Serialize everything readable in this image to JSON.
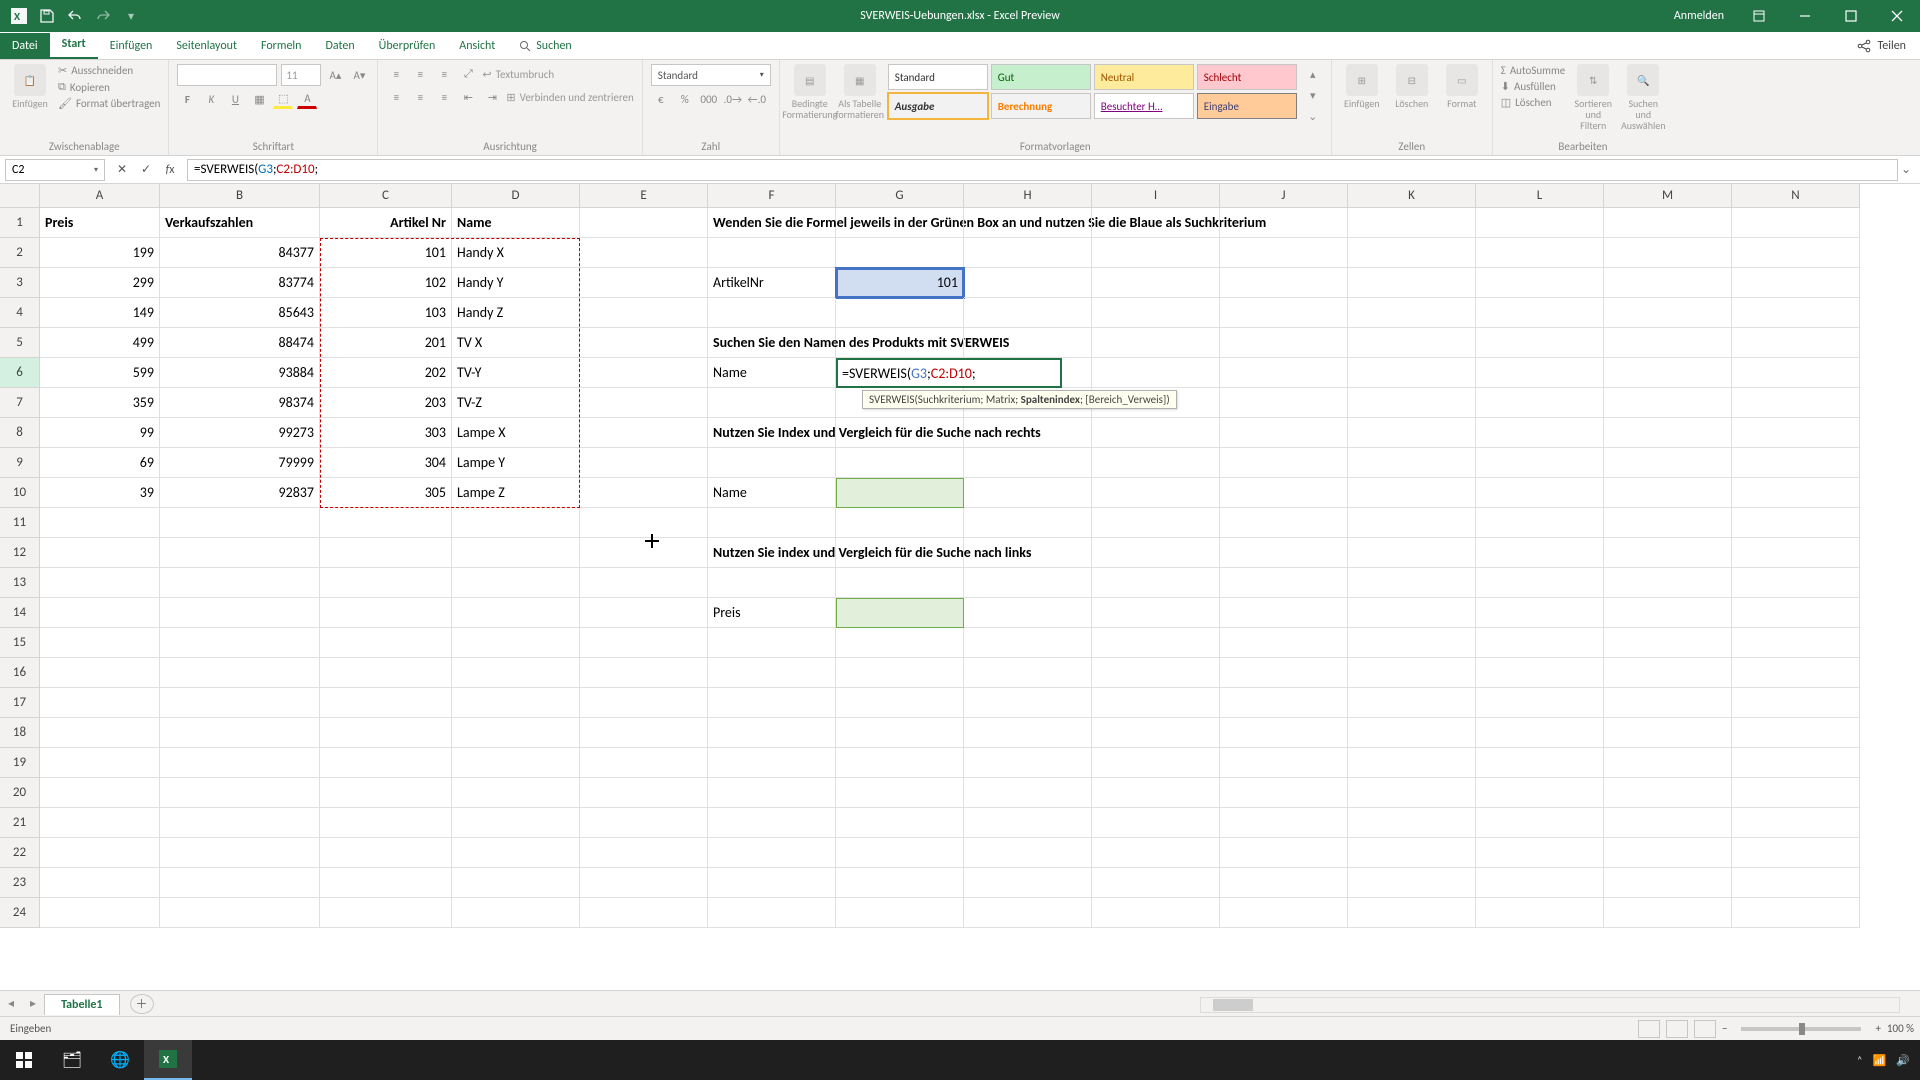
{
  "titlebar": {
    "title": "SVERWEIS-Uebungen.xlsx - Excel Preview",
    "login": "Anmelden"
  },
  "tabs": {
    "file": "Datei",
    "start": "Start",
    "einfugen": "Einfügen",
    "seitenlayout": "Seitenlayout",
    "formeln": "Formeln",
    "daten": "Daten",
    "uberprufen": "Überprüfen",
    "ansicht": "Ansicht",
    "suchen": "Suchen",
    "share": "Teilen"
  },
  "ribbon": {
    "clipboard": {
      "label": "Zwischenablage",
      "paste": "Einfügen",
      "cut": "Ausschneiden",
      "copy": "Kopieren",
      "format_painter": "Format übertragen"
    },
    "font": {
      "label": "Schriftart",
      "name": "",
      "size": "11"
    },
    "align": {
      "label": "Ausrichtung",
      "wrap": "Textumbruch",
      "merge": "Verbinden und zentrieren"
    },
    "number": {
      "label": "Zahl",
      "format": "Standard"
    },
    "styles": {
      "label": "Formatvorlagen",
      "cond": "Bedingte Formatierung",
      "table": "Als Tabelle formatieren",
      "s1": "Standard",
      "s2": "Gut",
      "s3": "Neutral",
      "s4": "Schlecht",
      "s5": "Ausgabe",
      "s6": "Berechnung",
      "s7": "Besuchter H…",
      "s8": "Eingabe"
    },
    "cells": {
      "label": "Zellen",
      "insert": "Einfügen",
      "delete": "Löschen",
      "format": "Format"
    },
    "editing": {
      "label": "Bearbeiten",
      "autosum": "AutoSumme",
      "fill": "Ausfüllen",
      "clear": "Löschen",
      "sort": "Sortieren und Filtern",
      "find": "Suchen und Auswählen"
    }
  },
  "namebox": "C2",
  "formula": {
    "prefix": "=SVERWEIS(",
    "arg1": "G3",
    "sep1": ";",
    "arg2": "C2:D10",
    "sep2": ";"
  },
  "func_tip": {
    "name": "SVERWEIS",
    "a1": "Suchkriterium",
    "a2": "Matrix",
    "a3": "Spaltenindex",
    "a4": "[Bereich_Verweis]"
  },
  "grid": {
    "headers": {
      "A": "Preis",
      "B": "Verkaufszahlen",
      "C": "Artikel Nr",
      "D": "Name"
    },
    "rows": [
      {
        "A": "199",
        "B": "84377",
        "C": "101",
        "D": "Handy X"
      },
      {
        "A": "299",
        "B": "83774",
        "C": "102",
        "D": "Handy Y"
      },
      {
        "A": "149",
        "B": "85643",
        "C": "103",
        "D": "Handy Z"
      },
      {
        "A": "499",
        "B": "88474",
        "C": "201",
        "D": "TV X"
      },
      {
        "A": "599",
        "B": "93884",
        "C": "202",
        "D": "TV-Y"
      },
      {
        "A": "359",
        "B": "98374",
        "C": "203",
        "D": "TV-Z"
      },
      {
        "A": "99",
        "B": "99273",
        "C": "303",
        "D": "Lampe X"
      },
      {
        "A": "69",
        "B": "79999",
        "C": "304",
        "D": "Lampe Y"
      },
      {
        "A": "39",
        "B": "92837",
        "C": "305",
        "D": "Lampe Z"
      }
    ],
    "F1": "Wenden Sie die Formel jeweils in der Grünen Box an und nutzen Sie die Blaue als Suchkriterium",
    "F3": "ArtikelNr",
    "G3": "101",
    "F5": "Suchen Sie den Namen des Produkts mit SVERWEIS",
    "F6": "Name",
    "F8": "Nutzen Sie Index und Vergleich für die Suche nach rechts",
    "F10": "Name",
    "F12": "Nutzen Sie index und Vergleich für die Suche nach links",
    "F14": "Preis"
  },
  "sheet": {
    "active": "Tabelle1"
  },
  "status": {
    "mode": "Eingeben",
    "zoom": "100 %"
  },
  "colors": {
    "brand": "#217346"
  }
}
